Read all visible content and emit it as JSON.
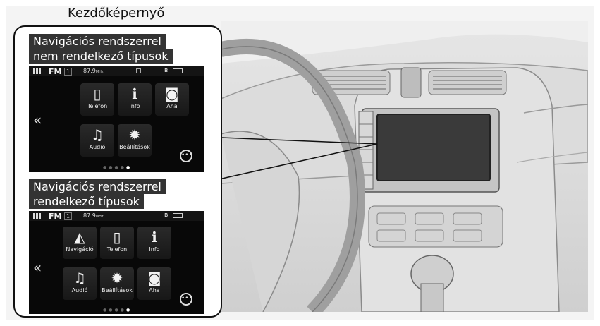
{
  "page": {
    "title": "Kezdőképernyő"
  },
  "variants": [
    {
      "label_line1": "Navigációs rendszerrel",
      "label_line2": "nem rendelkező típusok",
      "status": {
        "source": "FM",
        "preset": "1",
        "frequency": "87.9",
        "freq_unit": "MHz"
      },
      "tiles": [
        {
          "label": "Telefon",
          "icon": "phone-icon"
        },
        {
          "label": "Info",
          "icon": "info-icon"
        },
        {
          "label": "Aha",
          "icon": "aha-icon"
        },
        {
          "label": "Audió",
          "icon": "music-note-icon"
        },
        {
          "label": "Beállítások",
          "icon": "gear-icon"
        }
      ]
    },
    {
      "label_line1": "Navigációs rendszerrel",
      "label_line2": "rendelkező típusok",
      "status": {
        "source": "FM",
        "preset": "1",
        "frequency": "87.9",
        "freq_unit": "MHz"
      },
      "tiles": [
        {
          "label": "Navigáció",
          "icon": "navigation-icon"
        },
        {
          "label": "Telefon",
          "icon": "phone-icon"
        },
        {
          "label": "Info",
          "icon": "info-icon"
        },
        {
          "label": "Audió",
          "icon": "music-note-icon"
        },
        {
          "label": "Beállítások",
          "icon": "gear-icon"
        },
        {
          "label": "Aha",
          "icon": "aha-icon"
        }
      ]
    }
  ],
  "icons": {
    "chevrons": "«",
    "more": "•••",
    "grid": "apps-grid-icon"
  }
}
